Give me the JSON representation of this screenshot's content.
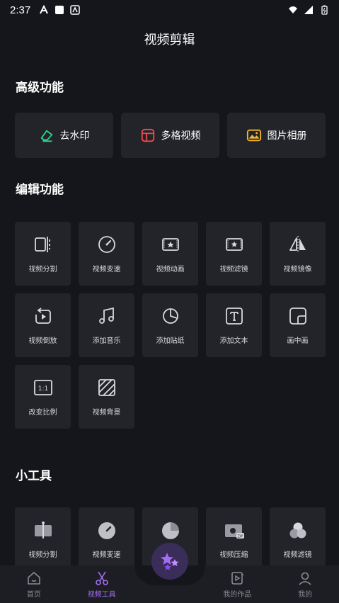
{
  "status": {
    "time": "2:37"
  },
  "page": {
    "title": "视频剪辑"
  },
  "advanced": {
    "title": "高级功能",
    "items": [
      {
        "label": "去水印",
        "icon": "eraser-icon",
        "color": "#2ecf8a"
      },
      {
        "label": "多格视频",
        "icon": "grid-layout-icon",
        "color": "#f04b4b"
      },
      {
        "label": "图片相册",
        "icon": "photo-album-icon",
        "color": "#f5b82e"
      }
    ]
  },
  "edit": {
    "title": "编辑功能",
    "items": [
      {
        "label": "视频分割",
        "icon": "split-icon"
      },
      {
        "label": "视频变速",
        "icon": "speedometer-icon"
      },
      {
        "label": "视频动画",
        "icon": "animation-icon"
      },
      {
        "label": "视频滤镜",
        "icon": "filter-icon"
      },
      {
        "label": "视频镜像",
        "icon": "mirror-icon"
      },
      {
        "label": "视频倒放",
        "icon": "reverse-icon"
      },
      {
        "label": "添加音乐",
        "icon": "music-icon"
      },
      {
        "label": "添加贴纸",
        "icon": "sticker-icon"
      },
      {
        "label": "添加文本",
        "icon": "text-icon"
      },
      {
        "label": "画中画",
        "icon": "pip-icon"
      },
      {
        "label": "改变比例",
        "icon": "ratio-icon"
      },
      {
        "label": "视频背景",
        "icon": "background-icon"
      }
    ]
  },
  "tools": {
    "title": "小工具",
    "items": [
      {
        "label": "视频分割",
        "icon": "split-filled-icon"
      },
      {
        "label": "视频变速",
        "icon": "speedometer-filled-icon"
      },
      {
        "label": "",
        "icon": "sticker-filled-icon"
      },
      {
        "label": "视频压缩",
        "icon": "compress-icon"
      },
      {
        "label": "视频滤镜",
        "icon": "filter-circles-icon"
      }
    ]
  },
  "nav": {
    "items": [
      {
        "label": "首页",
        "icon": "home-icon"
      },
      {
        "label": "视频工具",
        "icon": "scissors-icon"
      },
      {
        "label": "",
        "icon": ""
      },
      {
        "label": "我的作品",
        "icon": "works-icon"
      },
      {
        "label": "我的",
        "icon": "profile-icon"
      }
    ],
    "accent": "#a46ef2"
  }
}
